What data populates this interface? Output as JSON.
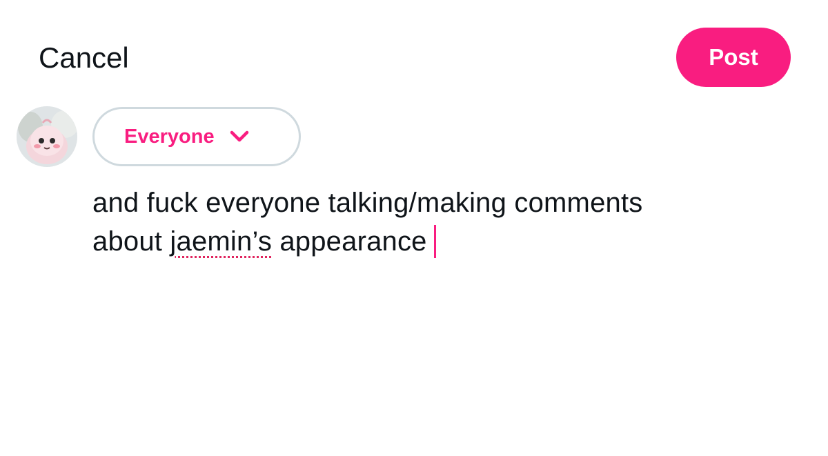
{
  "header": {
    "cancel_label": "Cancel",
    "post_label": "Post"
  },
  "colors": {
    "accent": "#f91d80",
    "text": "#0f1419",
    "border": "#cfd9de",
    "spellcheck_underline": "#e0245e"
  },
  "avatar": {
    "icon": "pink-plush-avatar"
  },
  "audience": {
    "selected": "Everyone",
    "icon": "chevron-down-icon"
  },
  "composer": {
    "line1": "and fuck everyone talking/making comments",
    "line2_before": "about ",
    "line2_misspelled": "jaemin’s",
    "line2_after": " appearance"
  }
}
